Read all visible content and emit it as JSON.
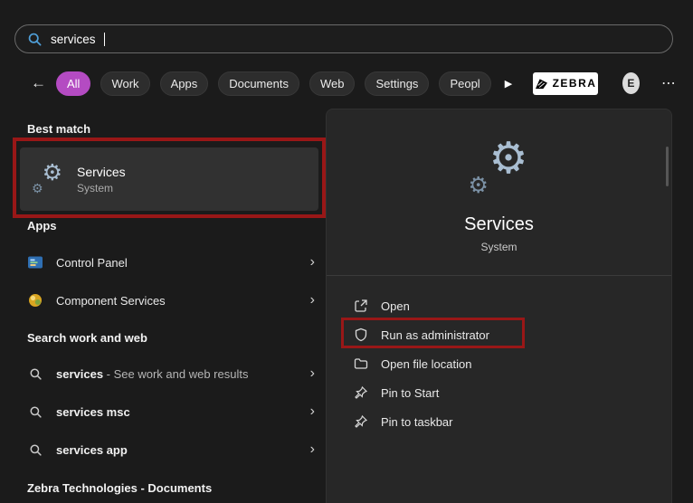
{
  "search": {
    "value": "services"
  },
  "icons": {
    "gear": "⚙",
    "chevron": "›",
    "back": "←",
    "play": "▶",
    "more": "⋯"
  },
  "filters": {
    "tabs": [
      {
        "label": "All",
        "active": true
      },
      {
        "label": "Work"
      },
      {
        "label": "Apps"
      },
      {
        "label": "Documents"
      },
      {
        "label": "Web"
      },
      {
        "label": "Settings"
      },
      {
        "label": "Peopl"
      }
    ],
    "zebra_label": "ZEBRA",
    "avatar_initial": "E"
  },
  "left": {
    "best_match_heading": "Best match",
    "best_match": {
      "title": "Services",
      "subtitle": "System",
      "icon": "services-gear-icon"
    },
    "apps_heading": "Apps",
    "apps": [
      {
        "label": "Control Panel",
        "icon": "control-panel-icon"
      },
      {
        "label": "Component Services",
        "icon": "component-services-icon"
      }
    ],
    "web_heading": "Search work and web",
    "web": [
      {
        "query": "services",
        "suffix": " - See work and web results"
      },
      {
        "query": "services msc",
        "suffix": ""
      },
      {
        "query": "services app",
        "suffix": ""
      }
    ],
    "documents_heading": "Zebra Technologies - Documents"
  },
  "preview": {
    "title": "Services",
    "subtitle": "System",
    "icon": "services-gear-icon",
    "actions": [
      {
        "label": "Open",
        "icon": "open-icon"
      },
      {
        "label": "Run as administrator",
        "icon": "admin-shield-icon",
        "highlighted": true
      },
      {
        "label": "Open file location",
        "icon": "folder-icon"
      },
      {
        "label": "Pin to Start",
        "icon": "pin-icon"
      },
      {
        "label": "Pin to taskbar",
        "icon": "pin-icon"
      }
    ]
  },
  "annotations": {
    "color": "#991717",
    "boxes": [
      "best-match-services",
      "run-as-administrator"
    ]
  },
  "colors": {
    "background": "#1b1b1b",
    "panel": "#272727",
    "accent_pill": "#b44bc2",
    "annotation_red": "#991717"
  }
}
